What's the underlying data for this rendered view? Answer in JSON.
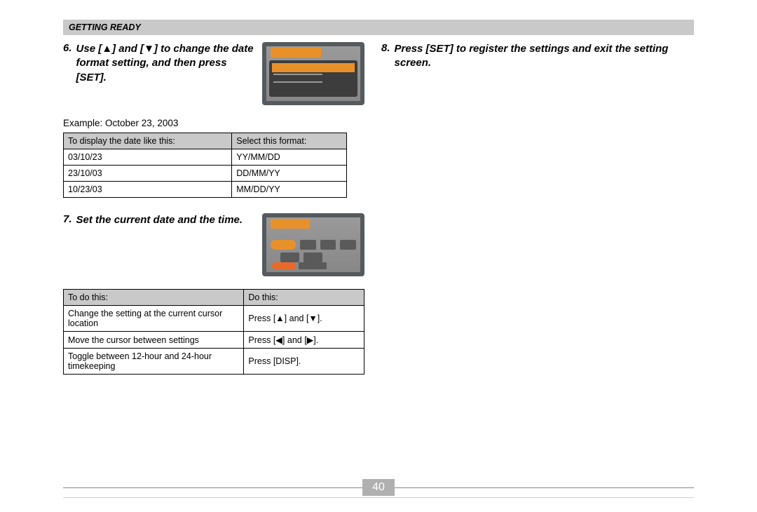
{
  "header": {
    "title": "GETTING READY"
  },
  "upTri": "▲",
  "downTri": "▼",
  "leftTri": "◀",
  "rightTri": "▶",
  "step6": {
    "num": "6.",
    "text_parts": [
      "Use [",
      "] and [",
      "] to change the date format setting, and then press [SET]."
    ]
  },
  "exampleLine": "Example: October 23, 2003",
  "table1": {
    "h1": "To display the date like this:",
    "h2": "Select this format:",
    "rows": [
      {
        "c1": "03/10/23",
        "c2": "YY/MM/DD"
      },
      {
        "c1": "23/10/03",
        "c2": "DD/MM/YY"
      },
      {
        "c1": "10/23/03",
        "c2": "MM/DD/YY"
      }
    ]
  },
  "step7": {
    "num": "7.",
    "text": "Set the current date and the time."
  },
  "table2": {
    "h1": "To do this:",
    "h2": "Do this:",
    "rows": [
      {
        "c1": "Change the setting at the current cursor location",
        "c2_parts": [
          "Press [",
          "] and [",
          "]."
        ]
      },
      {
        "c1": "Move the cursor between settings",
        "c2_parts": [
          "Press [",
          "] and [",
          "]."
        ]
      },
      {
        "c1": "Toggle between 12-hour and 24-hour timekeeping",
        "c2_plain": "Press [DISP]."
      }
    ]
  },
  "step8": {
    "num": "8.",
    "text": "Press [SET] to register the settings and exit the setting screen."
  },
  "pageNumber": "40"
}
